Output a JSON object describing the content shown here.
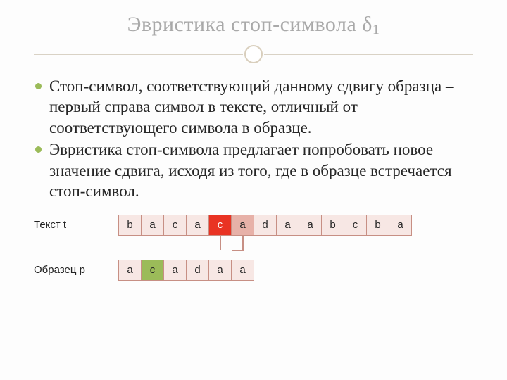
{
  "title": {
    "main": "Эвристика стоп-символа δ",
    "sub": "1"
  },
  "bullets": [
    "Стоп-символ, соответствующий данному сдвигу образца – первый справа символ в тексте, отличный от соответствующего символа в образце.",
    "Эвристика стоп-символа предлагает попробовать новое значение сдвига, исходя из того, где в образце встречается стоп-символ."
  ],
  "text_row": {
    "label": "Текст t",
    "cells": [
      {
        "v": "b",
        "c": ""
      },
      {
        "v": "a",
        "c": ""
      },
      {
        "v": "c",
        "c": ""
      },
      {
        "v": "a",
        "c": ""
      },
      {
        "v": "c",
        "c": "hl-red"
      },
      {
        "v": "a",
        "c": "hl-dark"
      },
      {
        "v": "d",
        "c": ""
      },
      {
        "v": "a",
        "c": ""
      },
      {
        "v": "a",
        "c": ""
      },
      {
        "v": "b",
        "c": ""
      },
      {
        "v": "c",
        "c": ""
      },
      {
        "v": "b",
        "c": ""
      },
      {
        "v": "a",
        "c": ""
      }
    ]
  },
  "pattern_row": {
    "label": "Образец p",
    "cells": [
      {
        "v": "a",
        "c": ""
      },
      {
        "v": "c",
        "c": "hl-green"
      },
      {
        "v": "a",
        "c": ""
      },
      {
        "v": "d",
        "c": ""
      },
      {
        "v": "a",
        "c": ""
      },
      {
        "v": "a",
        "c": ""
      }
    ]
  }
}
